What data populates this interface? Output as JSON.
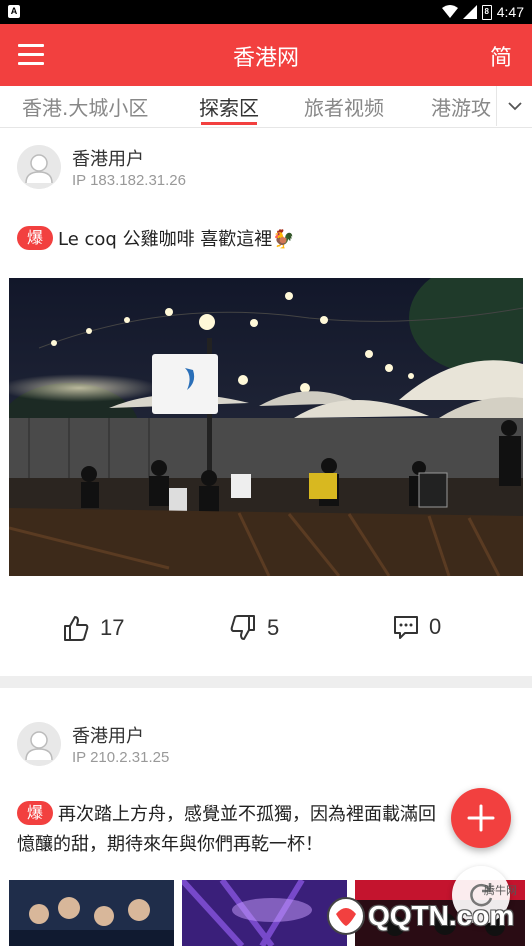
{
  "status_bar": {
    "time": "4:47",
    "battery_level": "8",
    "icons": [
      "wifi-icon",
      "signal-icon",
      "battery-icon"
    ]
  },
  "app_bar": {
    "title": "香港网",
    "lang_toggle": "简",
    "menu_icon": "hamburger-menu-icon"
  },
  "tabs": {
    "items": [
      {
        "label": "香港.大城小区",
        "active": false
      },
      {
        "label": "探索区",
        "active": true
      },
      {
        "label": "旅者视频",
        "active": false
      },
      {
        "label": "港游攻",
        "active": false
      }
    ],
    "more_icon": "chevron-down-icon"
  },
  "posts": [
    {
      "user": "香港用户",
      "ip": "IP 183.182.31.26",
      "badge": "爆",
      "text": "Le coq 公雞咖啡 喜歡這裡🐓",
      "likes": "17",
      "dislikes": "5",
      "comments": "0"
    },
    {
      "user": "香港用户",
      "ip": "IP 210.2.31.25",
      "badge": "爆",
      "text": "再次踏上方舟，感覺並不孤獨，因為裡面載滿回憶釀的甜，期待來年與你們再乾一杯！"
    }
  ],
  "fab": {
    "icon": "plus-icon"
  },
  "refresh": {
    "icon": "refresh-icon"
  },
  "watermark": {
    "brand": "QQTN.com",
    "sub": "腾牛网"
  },
  "colors": {
    "accent": "#f2403f",
    "divider": "#eeeeee",
    "muted": "#999999"
  }
}
